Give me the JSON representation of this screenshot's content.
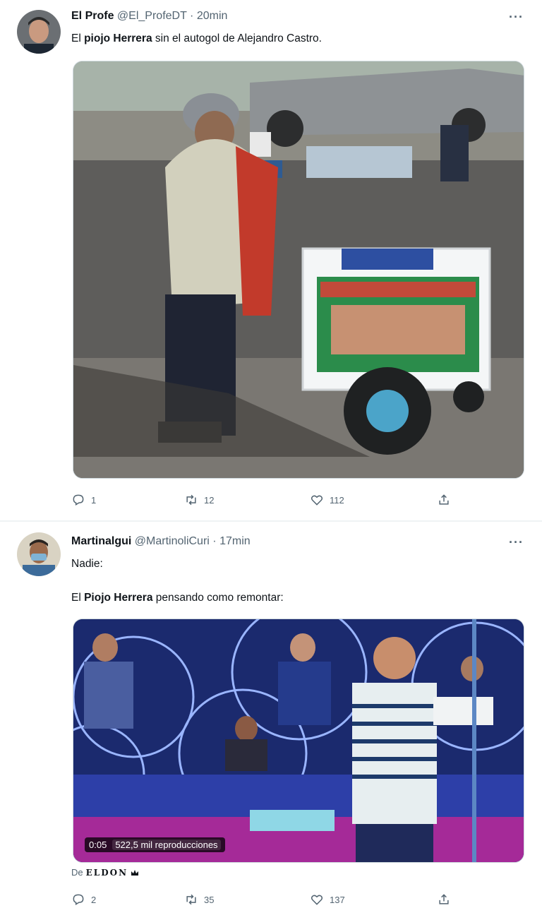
{
  "tweets": [
    {
      "author_name": "El Profe",
      "handle": "@El_ProfeDT",
      "time": "20min",
      "text_parts": [
        "El ",
        "piojo Herrera",
        " sin el autogol de Alejandro Castro."
      ],
      "actions": {
        "replies": "1",
        "retweets": "12",
        "likes": "112"
      }
    },
    {
      "author_name": "Martinalgui",
      "handle": "@MartinoliCuri",
      "time": "17min",
      "line1": "Nadie:",
      "text_parts": [
        "El ",
        "Piojo Herrera",
        " pensando como remontar:"
      ],
      "video": {
        "time": "0:05",
        "views": "522,5 mil reproducciones"
      },
      "from_prefix": "De",
      "from_brand": "ELDON",
      "actions": {
        "replies": "2",
        "retweets": "35",
        "likes": "137"
      }
    }
  ],
  "common": {
    "dot": "·",
    "more": "···"
  },
  "icons": {
    "reply": "reply-icon",
    "retweet": "retweet-icon",
    "like": "heart-icon",
    "share": "share-icon"
  },
  "colors": {
    "muted": "#536471",
    "text": "#0f1419",
    "border": "#cfd9de"
  }
}
